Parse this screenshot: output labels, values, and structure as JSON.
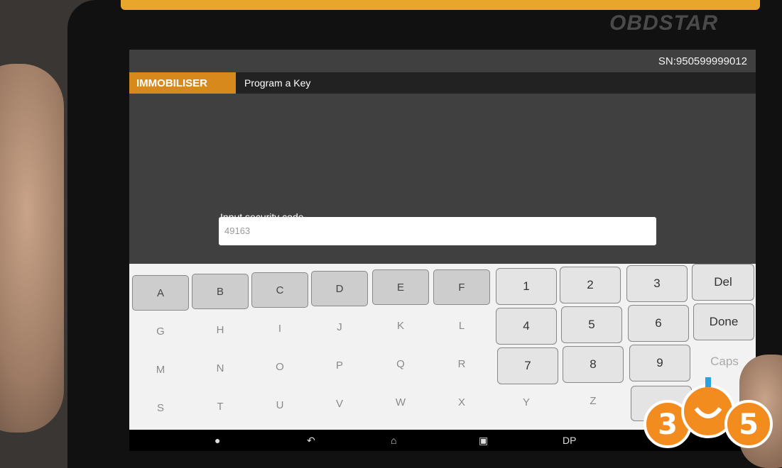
{
  "device": {
    "brand": "OBDSTAR"
  },
  "status": {
    "serial": "SN:950599999012"
  },
  "header": {
    "module": "IMMOBILISER",
    "title": "Program a Key"
  },
  "form": {
    "label": "Input security code",
    "value": "49163"
  },
  "keyboard": {
    "letters": [
      "A",
      "B",
      "C",
      "D",
      "E",
      "F",
      "G",
      "H",
      "I",
      "J",
      "K",
      "L",
      "M",
      "N",
      "O",
      "P",
      "Q",
      "R",
      "S",
      "T",
      "U",
      "V",
      "W",
      "Z"
    ],
    "letters_row4": [
      "S",
      "T",
      "U",
      "V",
      "W",
      "X",
      "Y",
      "Z"
    ],
    "numbers": [
      "1",
      "2",
      "3",
      "4",
      "5",
      "6",
      "7",
      "8",
      "9"
    ],
    "del": "Del",
    "done": "Done",
    "caps": "Caps"
  },
  "navbar": {
    "dp": "DP"
  },
  "watermark": {
    "text": "365"
  }
}
